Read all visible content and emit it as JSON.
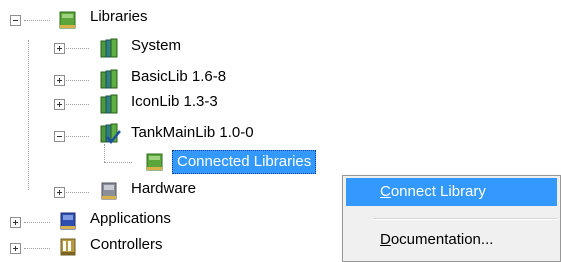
{
  "tree": {
    "libraries_label": "Libraries",
    "system_label": "System",
    "basiclib_label": "BasicLib 1.6-8",
    "iconlib_label": "IconLib 1.3-3",
    "tankmainlib_label": "TankMainLib 1.0-0",
    "connected_libraries_label": "Connected Libraries",
    "hardware_label": "Hardware",
    "applications_label": "Applications",
    "controllers_label": "Controllers"
  },
  "context_menu": {
    "connect_library": {
      "first": "C",
      "rest": "onnect Library"
    },
    "documentation": {
      "first": "D",
      "rest": "ocumentation..."
    }
  },
  "colors": {
    "selection": "#3399ff",
    "book_green": "#4f9a3a",
    "book_teal": "#2f7f84"
  }
}
